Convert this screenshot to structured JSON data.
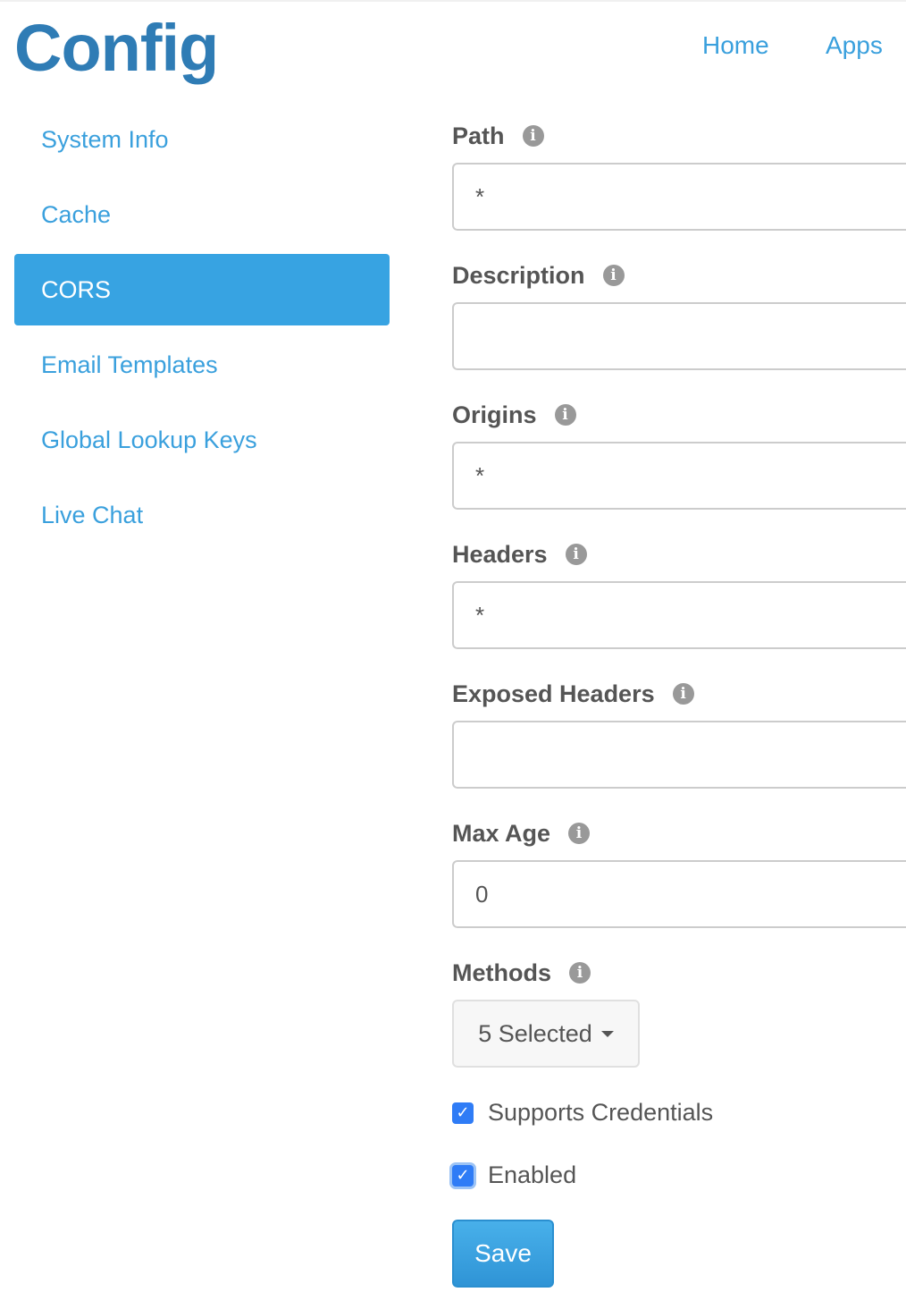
{
  "header": {
    "title": "Config",
    "nav": [
      {
        "label": "Home"
      },
      {
        "label": "Apps"
      }
    ]
  },
  "sidebar": {
    "items": [
      {
        "label": "System Info"
      },
      {
        "label": "Cache"
      },
      {
        "label": "CORS",
        "active": true
      },
      {
        "label": "Email Templates"
      },
      {
        "label": "Global Lookup Keys"
      },
      {
        "label": "Live Chat"
      }
    ]
  },
  "form": {
    "path": {
      "label": "Path",
      "value": "*"
    },
    "description": {
      "label": "Description",
      "value": ""
    },
    "origins": {
      "label": "Origins",
      "value": "*"
    },
    "headers": {
      "label": "Headers",
      "value": "*"
    },
    "exposed_headers": {
      "label": "Exposed Headers",
      "value": ""
    },
    "max_age": {
      "label": "Max Age",
      "value": "0"
    },
    "methods": {
      "label": "Methods",
      "selected": "5 Selected"
    },
    "supports_credentials": {
      "label": "Supports Credentials",
      "checked": true
    },
    "enabled": {
      "label": "Enabled",
      "checked": true
    },
    "save_label": "Save"
  },
  "icons": {
    "info": "info-icon",
    "checkmark": "checkmark-icon",
    "caret": "caret-down-icon"
  },
  "colors": {
    "brand": "#2f7cb5",
    "link": "#3aa0dd",
    "active_nav": "#37a3e2",
    "checkbox": "#2f7cf6",
    "button": "#3aa0e0"
  }
}
